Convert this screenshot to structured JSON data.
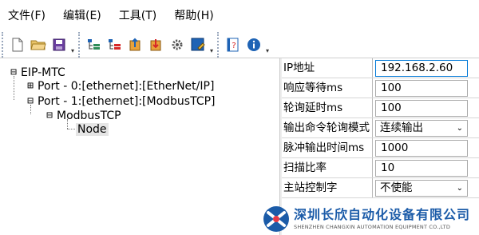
{
  "menubar": {
    "items": [
      {
        "label": "文件(F)"
      },
      {
        "label": "编辑(E)"
      },
      {
        "label": "工具(T)"
      },
      {
        "label": "帮助(H)"
      }
    ]
  },
  "toolbar": {
    "groups": [
      [
        "new-file-icon",
        "open-folder-icon",
        "save-icon"
      ],
      [
        "add-node-icon",
        "remove-node-icon",
        "upload-icon",
        "download-icon",
        "settings-gear-icon",
        "properties-icon"
      ],
      [
        "help-book-icon",
        "info-icon"
      ]
    ],
    "accent": "#1e63b5"
  },
  "tree": {
    "root": "EIP-MTC",
    "port0": "Port - 0:[ethernet]:[EtherNet/IP]",
    "port1": "Port - 1:[ethernet]:[ModbusTCP]",
    "modbus": "ModbusTCP",
    "node": "Node",
    "expander_collapsed": "⊞",
    "expander_expanded": "⊟"
  },
  "properties": [
    {
      "name": "IP地址",
      "value": "192.168.2.60",
      "kind": "text"
    },
    {
      "name": "响应等待ms",
      "value": "100",
      "kind": "text"
    },
    {
      "name": "轮询延时ms",
      "value": "100",
      "kind": "text"
    },
    {
      "name": "输出命令轮询模式",
      "value": "连续输出",
      "kind": "select"
    },
    {
      "name": "脉冲输出时间ms",
      "value": "1000",
      "kind": "text"
    },
    {
      "name": "扫描比率",
      "value": "10",
      "kind": "text"
    },
    {
      "name": "主站控制字",
      "value": "不使能",
      "kind": "select"
    }
  ],
  "watermark": {
    "cn": "深圳长欣自动化设备有限公司",
    "en": "SHENZHEN CHANGXIN AUTOMATION EQUIPMENT CO.,LTD",
    "color": "#1b5ba8"
  }
}
